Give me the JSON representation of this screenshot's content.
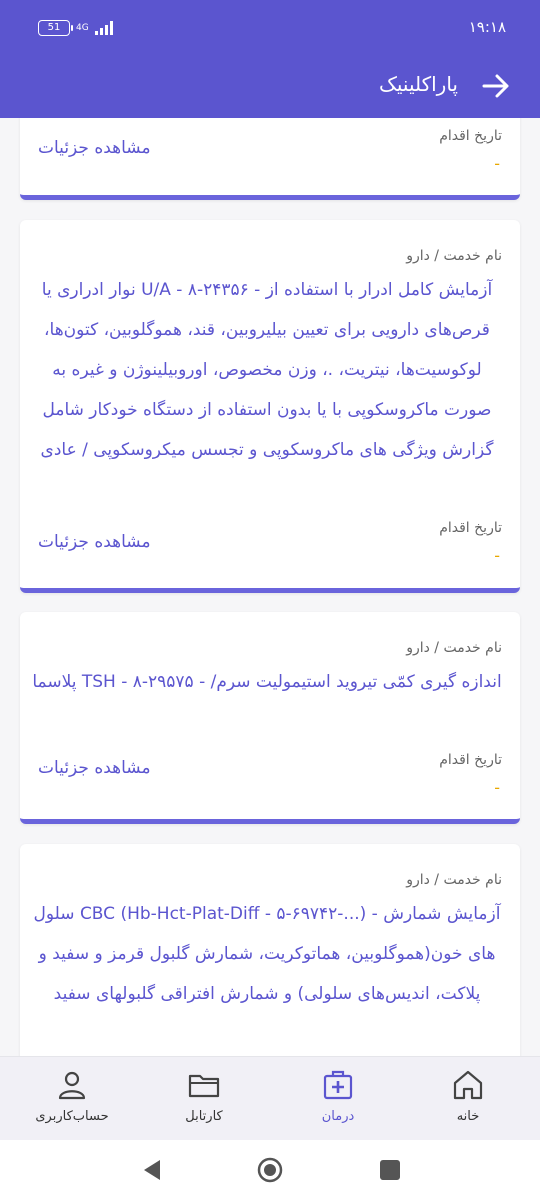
{
  "status_bar": {
    "time": "۱۹:۱۸",
    "battery": "51",
    "network": "4G"
  },
  "app_bar": {
    "title": "پاراکلینیک"
  },
  "cards": [
    {
      "date_label": "تاریخ اقدام",
      "date_value": "-",
      "details": "مشاهده جزئیات"
    },
    {
      "service_label": "نام خدمت / دارو",
      "service_name": "آزمایش کامل ادرار با استفاده از - U/A - ۸-۲۴۳۵۶ نوار ادراری یا قرص‌های دارویی برای تعیین بیلیروبین، قند، هموگلوبین، کتون‌ها، لوکوسیت‌ها، نیتریت، .، وزن مخصوص، اوروبیلینوژن و غیره به صورت ماکروسکوپی با یا بدون استفاده از دستگاه خودکار شامل گزارش ویژگی های ماکروسکوپی و تجسس میکروسکوپی / عادی",
      "date_label": "تاریخ اقدام",
      "date_value": "-",
      "details": "مشاهده جزئیات"
    },
    {
      "service_label": "نام خدمت / دارو",
      "service_name": "اندازه گیری کمّی تیروید استیمولیت سرم/ - TSH - ۸-۲۹۵۷۵ پلاسما",
      "date_label": "تاریخ اقدام",
      "date_value": "-",
      "details": "مشاهده جزئیات"
    },
    {
      "service_label": "نام خدمت / دارو",
      "service_name": "آزمایش شمارش - (...-CBC (Hb-Hct-Plat-Diff - ۵-۶۹۷۴۲ سلول های خون(هموگلوبین، هماتوکریت، شمارش گلبول قرمز و سفید و پلاکت، اندیس‌های سلولی) و شمارش افتراقی گلبولهای سفید"
    }
  ],
  "bottom_nav": [
    {
      "label": "خانه",
      "icon": "home-icon"
    },
    {
      "label": "درمان",
      "icon": "medical-kit-icon",
      "active": true
    },
    {
      "label": "کارتابل",
      "icon": "folder-icon"
    },
    {
      "label": "حساب‌کاربری",
      "icon": "user-icon"
    }
  ],
  "colors": {
    "primary": "#5b55cf",
    "accent": "#e8a800"
  }
}
